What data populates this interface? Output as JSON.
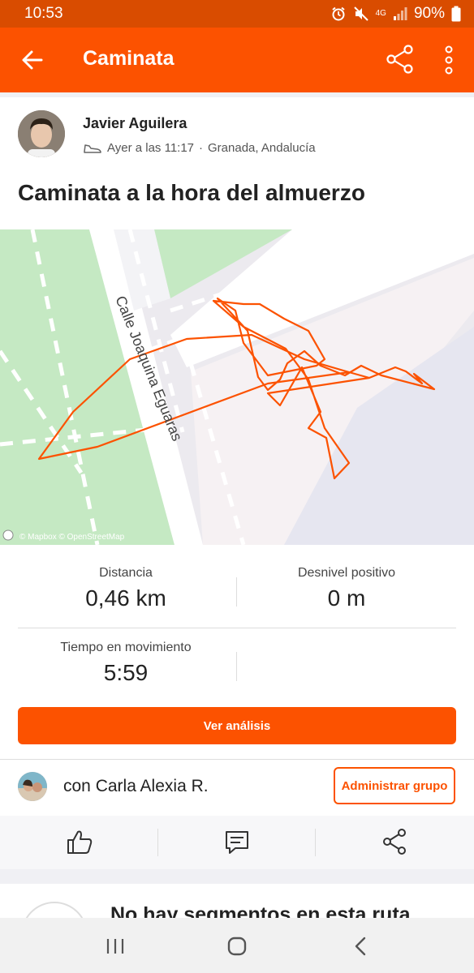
{
  "status_bar": {
    "time": "10:53",
    "battery": "90%",
    "network": "4G"
  },
  "app_bar": {
    "title": "Caminata"
  },
  "athlete": {
    "name": "Javier Aguilera",
    "date": "Ayer a las 11:17",
    "location": "Granada, Andalucía"
  },
  "activity": {
    "title": "Caminata a la hora del almuerzo"
  },
  "map": {
    "street_label": "Calle Joaquina Eguaras",
    "attribution": "© Mapbox © OpenStreetMap",
    "route_color": "#fc5200"
  },
  "stats": {
    "distance": {
      "label": "Distancia",
      "value": "0,46 km"
    },
    "elevation": {
      "label": "Desnivel positivo",
      "value": "0 m"
    },
    "moving_time": {
      "label": "Tiempo en movimiento",
      "value": "5:59"
    }
  },
  "analysis_button": {
    "label": "Ver análisis"
  },
  "group": {
    "text": "con Carla Alexia R.",
    "button_label": "Administrar grupo"
  },
  "segments": {
    "title": "No hay segmentos en esta ruta"
  },
  "colors": {
    "accent": "#fc5200",
    "status_bar": "#d94c00"
  },
  "icons": [
    "back-arrow-icon",
    "share-icon",
    "more-vert-icon",
    "shoe-icon",
    "thumbs-up-icon",
    "comment-icon",
    "share-icon",
    "recents-icon",
    "home-icon",
    "back-icon"
  ]
}
